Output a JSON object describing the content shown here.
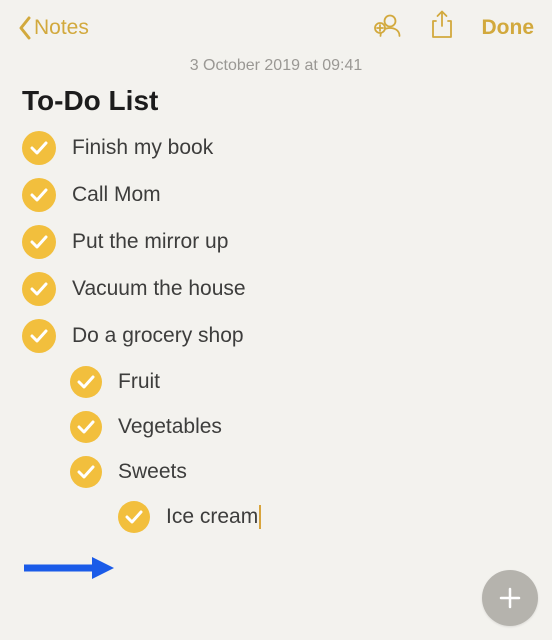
{
  "nav": {
    "back_label": "Notes",
    "done_label": "Done"
  },
  "timestamp": "3 October 2019 at 09:41",
  "note": {
    "title": "To-Do List",
    "items": [
      {
        "text": "Finish my book",
        "checked": true,
        "level": 0
      },
      {
        "text": "Call Mom",
        "checked": true,
        "level": 0
      },
      {
        "text": "Put the mirror up",
        "checked": true,
        "level": 0
      },
      {
        "text": "Vacuum the house",
        "checked": true,
        "level": 0
      },
      {
        "text": "Do a grocery shop",
        "checked": true,
        "level": 0
      },
      {
        "text": "Fruit",
        "checked": true,
        "level": 1
      },
      {
        "text": "Vegetables",
        "checked": true,
        "level": 1
      },
      {
        "text": "Sweets",
        "checked": true,
        "level": 1
      },
      {
        "text": "Ice cream",
        "checked": true,
        "level": 2,
        "cursor": true
      }
    ]
  },
  "colors": {
    "accent": "#d2a93d",
    "checkbox": "#f2bf3d",
    "arrow": "#1a5be8"
  }
}
